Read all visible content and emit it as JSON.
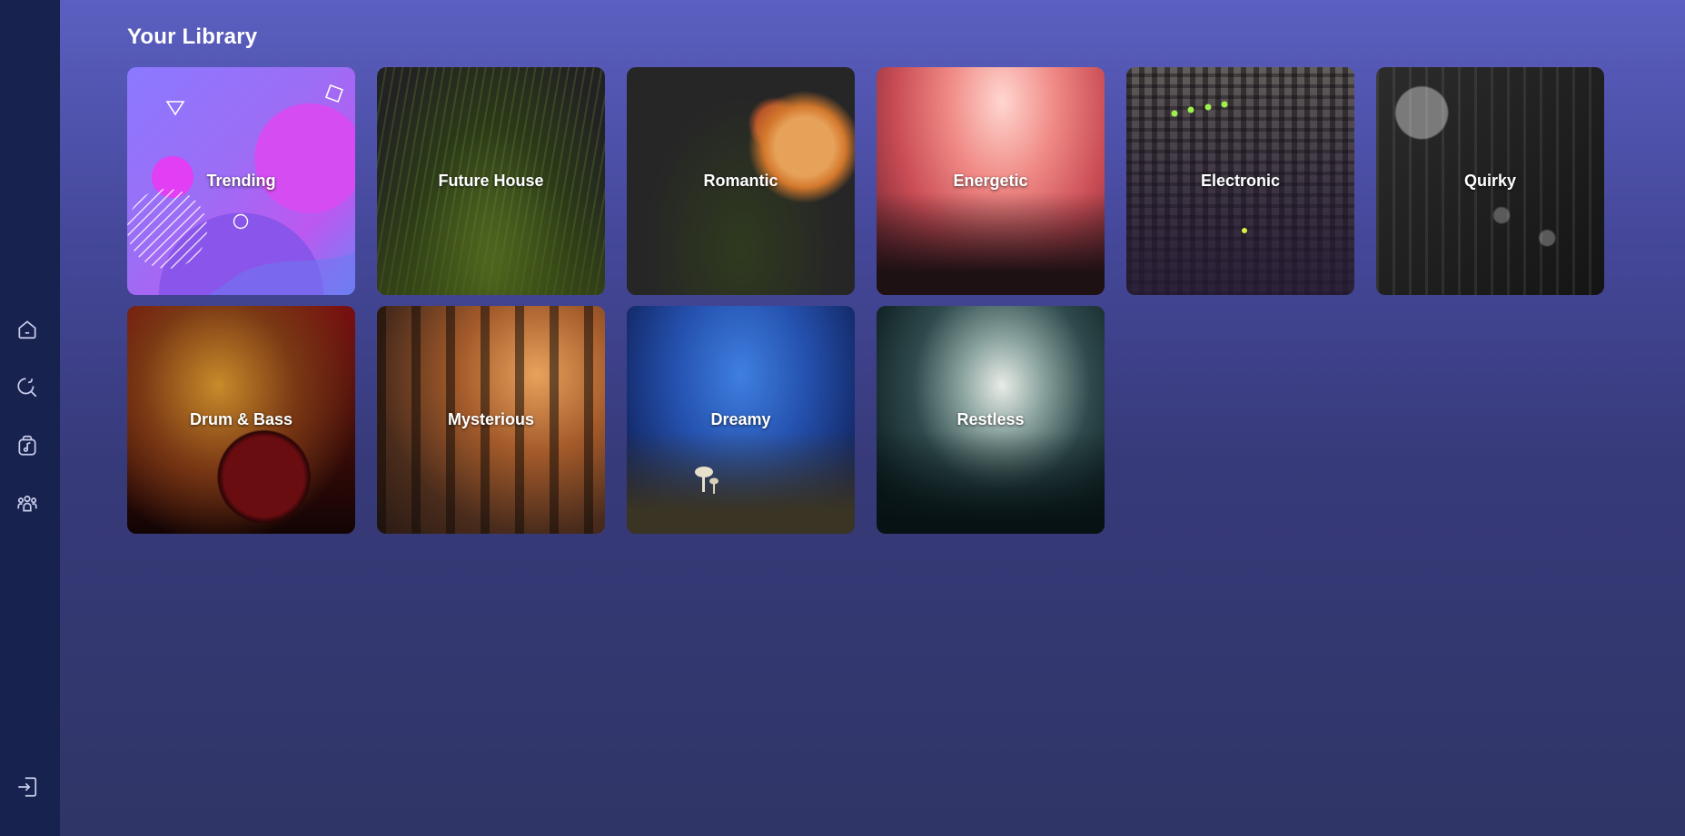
{
  "sidebar": {
    "items": [
      {
        "name": "home-icon"
      },
      {
        "name": "search-icon"
      },
      {
        "name": "music-library-icon"
      },
      {
        "name": "community-icon"
      },
      {
        "name": "sign-in-icon"
      }
    ]
  },
  "main": {
    "title": "Your Library",
    "cards": [
      {
        "label": "Trending"
      },
      {
        "label": "Future House"
      },
      {
        "label": "Romantic"
      },
      {
        "label": "Energetic"
      },
      {
        "label": "Electronic"
      },
      {
        "label": "Quirky"
      },
      {
        "label": "Drum & Bass"
      },
      {
        "label": "Mysterious"
      },
      {
        "label": "Dreamy"
      },
      {
        "label": "Restless"
      }
    ]
  },
  "colors": {
    "background_top": "#5b5fc0",
    "background_bottom": "#2f3566",
    "sidebar": "#18224f",
    "text": "#ffffff"
  }
}
